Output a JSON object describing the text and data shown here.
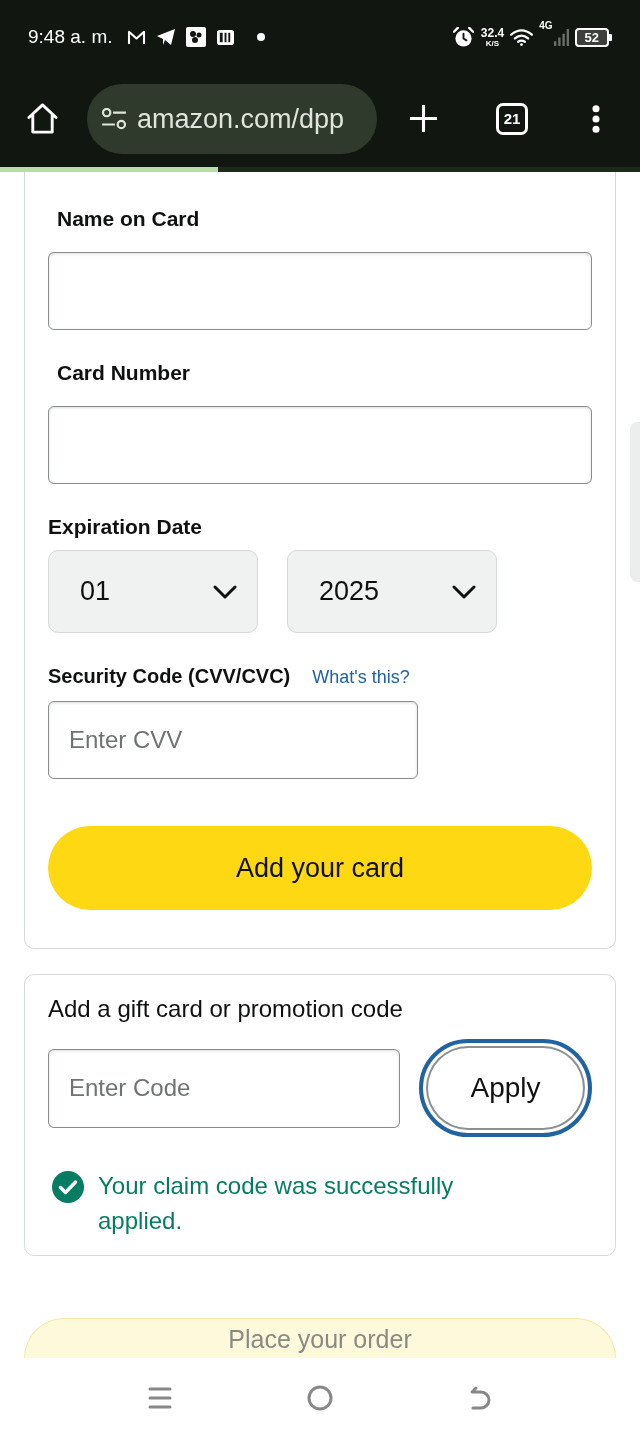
{
  "status_bar": {
    "time": "9:48 a. m.",
    "network_speed": "32.4",
    "network_speed_unit": "K/S",
    "network_type": "4G",
    "battery": "52"
  },
  "browser": {
    "url": "amazon.com/dpp",
    "tab_count": "21",
    "progress": {
      "level": 0.34
    }
  },
  "card_form": {
    "fields": [
      {
        "label": "Name on Card"
      },
      {
        "label": "Card Number"
      }
    ],
    "expiration": {
      "label": "Expiration Date",
      "month": "01",
      "year": "2025"
    },
    "security_code": {
      "label": "Security Code (CVV/CVC)",
      "help_link": "What's this?",
      "placeholder": "Enter CVV"
    },
    "submit_button": "Add your card"
  },
  "promo": {
    "title": "Add a gift card or promotion code",
    "placeholder": "Enter Code",
    "apply_button": {
      "label": "Apply",
      "focused": true
    },
    "message": "Your claim code was successfully applied."
  },
  "place_order_button": "Place your order"
}
